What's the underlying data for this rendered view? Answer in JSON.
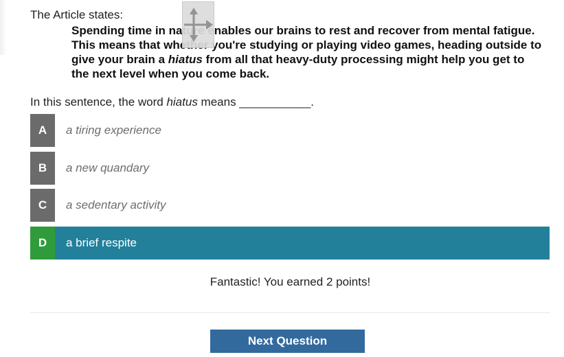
{
  "article_intro": "The Article states:",
  "quote": {
    "line1": "Spending time in nature enables our brains to rest and recover from mental fatigue.",
    "line2": "This means that whether you're studying or playing video games, heading outside to",
    "line3_before": "give your brain a ",
    "line3_emph": "hiatus",
    "line3_after": " from all that heavy-duty processing might help you get to",
    "line4": "the next level when you come back."
  },
  "question": {
    "before": "In this sentence, the word ",
    "term": "hiatus",
    "after": " means ___________."
  },
  "options": [
    {
      "letter": "A",
      "text": "a tiring experience"
    },
    {
      "letter": "B",
      "text": "a new quandary"
    },
    {
      "letter": "C",
      "text": "a sedentary activity"
    },
    {
      "letter": "D",
      "text": "a brief respite"
    }
  ],
  "selected_option": "D",
  "feedback": "Fantastic! You earned 2 points!",
  "next_button_label": "Next Question",
  "icons": {
    "move_handle": "move-arrows-icon"
  },
  "colors": {
    "option_letter_bg": "#6b6b6b",
    "selected_row_bg": "#23809b",
    "selected_letter_bg": "#2f9b3a",
    "next_button_bg": "#336a9e"
  }
}
